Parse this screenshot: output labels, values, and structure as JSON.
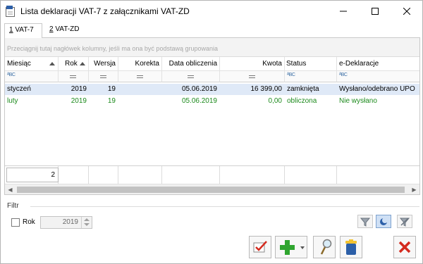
{
  "window": {
    "title": "Lista deklaracji VAT-7 z załącznikami VAT-ZD"
  },
  "tabs": [
    {
      "key": "1",
      "rest": " VAT-7",
      "active": true
    },
    {
      "key": "2",
      "rest": " VAT-ZD",
      "active": false
    }
  ],
  "grid": {
    "group_hint": "Przeciągnij tutaj nagłówek kolumny, jeśli ma ona być podstawą grupowania",
    "columns": {
      "miesiac": "Miesiąc",
      "rok": "Rok",
      "wersja": "Wersja",
      "korekta": "Korekta",
      "data": "Data obliczenia",
      "kwota": "Kwota",
      "status": "Status",
      "edekl": "e-Deklaracje"
    },
    "filter_text_icon": "ᴬBC",
    "rows": [
      {
        "miesiac": "styczeń",
        "rok": "2019",
        "wersja": "19",
        "korekta": "",
        "data": "05.06.2019",
        "kwota": "16 399,00",
        "status": "zamknięta",
        "edekl": "Wysłano/odebrano UPO"
      },
      {
        "miesiac": "luty",
        "rok": "2019",
        "wersja": "19",
        "korekta": "",
        "data": "05.06.2019",
        "kwota": "0,00",
        "status": "obliczona",
        "edekl": "Nie wysłano"
      }
    ],
    "footer_count": "2"
  },
  "filter": {
    "title": "Filtr",
    "rok_label": "Rok",
    "rok_value": "2019",
    "rok_checked": false
  },
  "colors": {
    "selected_row": "#dfe9f7",
    "computed_text": "#1c8a1c",
    "close_red": "#d42a1e",
    "add_green": "#2fa52f"
  },
  "icons": {
    "app": "vat-app-icon",
    "accept": "checkmark-icon",
    "add": "plus-icon",
    "preview": "magnifier-icon",
    "delete": "trash-icon",
    "close": "close-x-icon"
  }
}
